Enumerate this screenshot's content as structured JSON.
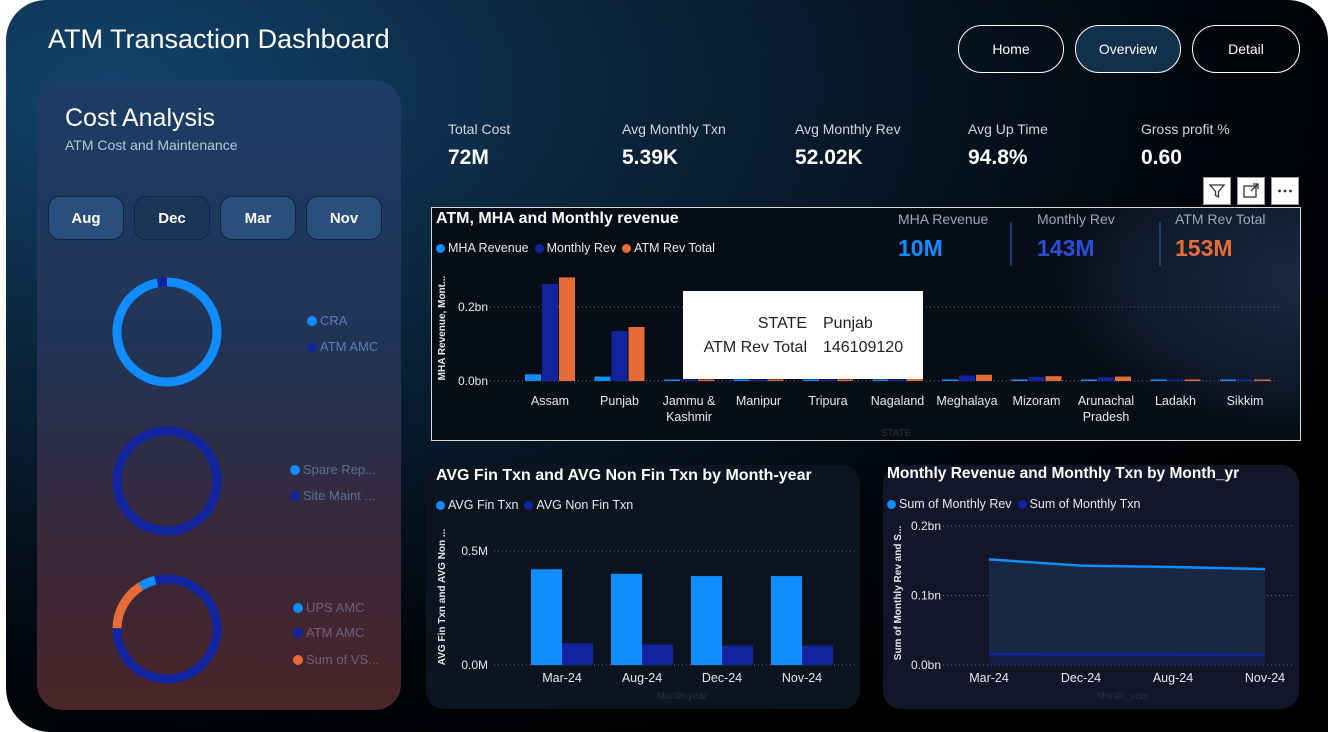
{
  "app": {
    "title": "ATM Transaction Dashboard"
  },
  "nav": {
    "home": "Home",
    "overview": "Overview",
    "detail": "Detail",
    "active": "Overview"
  },
  "cost_panel": {
    "title": "Cost Analysis",
    "subtitle": "ATM Cost and Maintenance",
    "months": [
      "Aug",
      "Dec",
      "Mar",
      "Nov"
    ],
    "selected_month": "Dec",
    "donut1": {
      "legend": [
        "CRA",
        "ATM AMC"
      ],
      "colors": [
        "#118dff",
        "#12239e"
      ],
      "shares": [
        0.97,
        0.03
      ]
    },
    "donut2": {
      "legend": [
        "Spare Rep...",
        "Site Maint ..."
      ],
      "colors": [
        "#118dff",
        "#12239e"
      ],
      "shares": [
        0.0,
        1.0
      ]
    },
    "donut3": {
      "legend": [
        "UPS AMC",
        "ATM AMC",
        "Sum of VS..."
      ],
      "colors": [
        "#118dff",
        "#12239e",
        "#e66c37"
      ],
      "shares": [
        0.05,
        0.79,
        0.16
      ]
    }
  },
  "kpis": [
    {
      "label": "Total Cost",
      "value": "72M"
    },
    {
      "label": "Avg Monthly Txn",
      "value": "5.39K"
    },
    {
      "label": "Avg Monthly Rev",
      "value": "52.02K"
    },
    {
      "label": "Avg Up Time",
      "value": "94.8%"
    },
    {
      "label": "Gross profit %",
      "value": "0.60"
    }
  ],
  "toolbar": {
    "icons": [
      "filter-icon",
      "focus-mode-icon",
      "more-options-icon"
    ]
  },
  "chart1": {
    "title": "ATM, MHA and Monthly revenue",
    "legend": [
      "MHA Revenue",
      "Monthly Rev",
      "ATM Rev Total"
    ],
    "kpi_cards": [
      {
        "label": "MHA Revenue",
        "value": "10M",
        "color": "#118dff"
      },
      {
        "label": "Monthly Rev",
        "value": "143M",
        "color": "#2c4dd6"
      },
      {
        "label": "ATM Rev Total",
        "value": "153M",
        "color": "#e66c37"
      }
    ],
    "ylabel": "MHA Revenue, Mont...",
    "xlabel": "STATE",
    "tooltip": {
      "k1": "STATE",
      "v1": "Punjab",
      "k2": "ATM Rev Total",
      "v2": "146109120"
    }
  },
  "chart2": {
    "title": "AVG Fin Txn and AVG Non Fin Txn by Month-year",
    "legend": [
      "AVG Fin Txn",
      "AVG Non Fin Txn"
    ],
    "ylabel": "AVG Fin Txn and AVG Non ...",
    "xlabel": "Month-year"
  },
  "chart3": {
    "title": "Monthly Revenue and Monthly Txn by Month_yr",
    "legend": [
      "Sum of Monthly Rev",
      "Sum of Monthly Txn"
    ],
    "ylabel": "Sum of Monthly Rev and S...",
    "xlabel": "Month_year"
  },
  "chart_data": [
    {
      "type": "bar",
      "title": "ATM, MHA and Monthly revenue",
      "xlabel": "STATE",
      "ylabel": "MHA Revenue, Mont...",
      "categories": [
        "Assam",
        "Punjab",
        "Jammu & Kashmir",
        "Manipur",
        "Tripura",
        "Nagaland",
        "Meghalaya",
        "Mizoram",
        "Arunachal Pradesh",
        "Ladakh",
        "Sikkim"
      ],
      "series": [
        {
          "name": "MHA Revenue",
          "color": "#118dff",
          "values": [
            0.018,
            0.012,
            0.002,
            0.001,
            0.001,
            0.001,
            0.002,
            0.002,
            0.002,
            0.001,
            0.001
          ]
        },
        {
          "name": "Monthly Rev",
          "color": "#12239e",
          "values": [
            0.262,
            0.135,
            0.002,
            0.002,
            0.002,
            0.002,
            0.015,
            0.011,
            0.01,
            0.003,
            0.002
          ]
        },
        {
          "name": "ATM Rev Total",
          "color": "#e66c37",
          "values": [
            0.28,
            0.146,
            0.003,
            0.003,
            0.003,
            0.025,
            0.017,
            0.013,
            0.012,
            0.004,
            0.003
          ]
        }
      ],
      "yticks": [
        "0.0bn",
        "0.2bn"
      ],
      "ylim": [
        0,
        0.3
      ],
      "grid": true,
      "legend_position": "top-left"
    },
    {
      "type": "bar",
      "title": "AVG Fin Txn and AVG Non Fin Txn by Month-year",
      "xlabel": "Month-year",
      "ylabel": "AVG Fin Txn and AVG Non ...",
      "categories": [
        "Mar-24",
        "Aug-24",
        "Dec-24",
        "Nov-24"
      ],
      "series": [
        {
          "name": "AVG Fin Txn",
          "color": "#118dff",
          "values": [
            0.42,
            0.4,
            0.39,
            0.39
          ]
        },
        {
          "name": "AVG Non Fin Txn",
          "color": "#12239e",
          "values": [
            0.095,
            0.09,
            0.085,
            0.085
          ]
        }
      ],
      "yticks": [
        "0.0M",
        "0.5M"
      ],
      "ylim": [
        0,
        0.55
      ],
      "grid": true,
      "legend_position": "top-left"
    },
    {
      "type": "area",
      "title": "Monthly Revenue and Monthly Txn by Month_yr",
      "xlabel": "Month_year",
      "ylabel": "Sum of Monthly Rev and S...",
      "categories": [
        "Mar-24",
        "Dec-24",
        "Aug-24",
        "Nov-24"
      ],
      "series": [
        {
          "name": "Sum of Monthly Rev",
          "color": "#118dff",
          "values": [
            0.152,
            0.143,
            0.141,
            0.138
          ]
        },
        {
          "name": "Sum of Monthly Txn",
          "color": "#12239e",
          "values": [
            0.016,
            0.015,
            0.015,
            0.014
          ]
        }
      ],
      "yticks": [
        "0.0bn",
        "0.1bn",
        "0.2bn"
      ],
      "ylim": [
        0,
        0.2
      ],
      "grid": true,
      "legend_position": "top-left"
    }
  ]
}
